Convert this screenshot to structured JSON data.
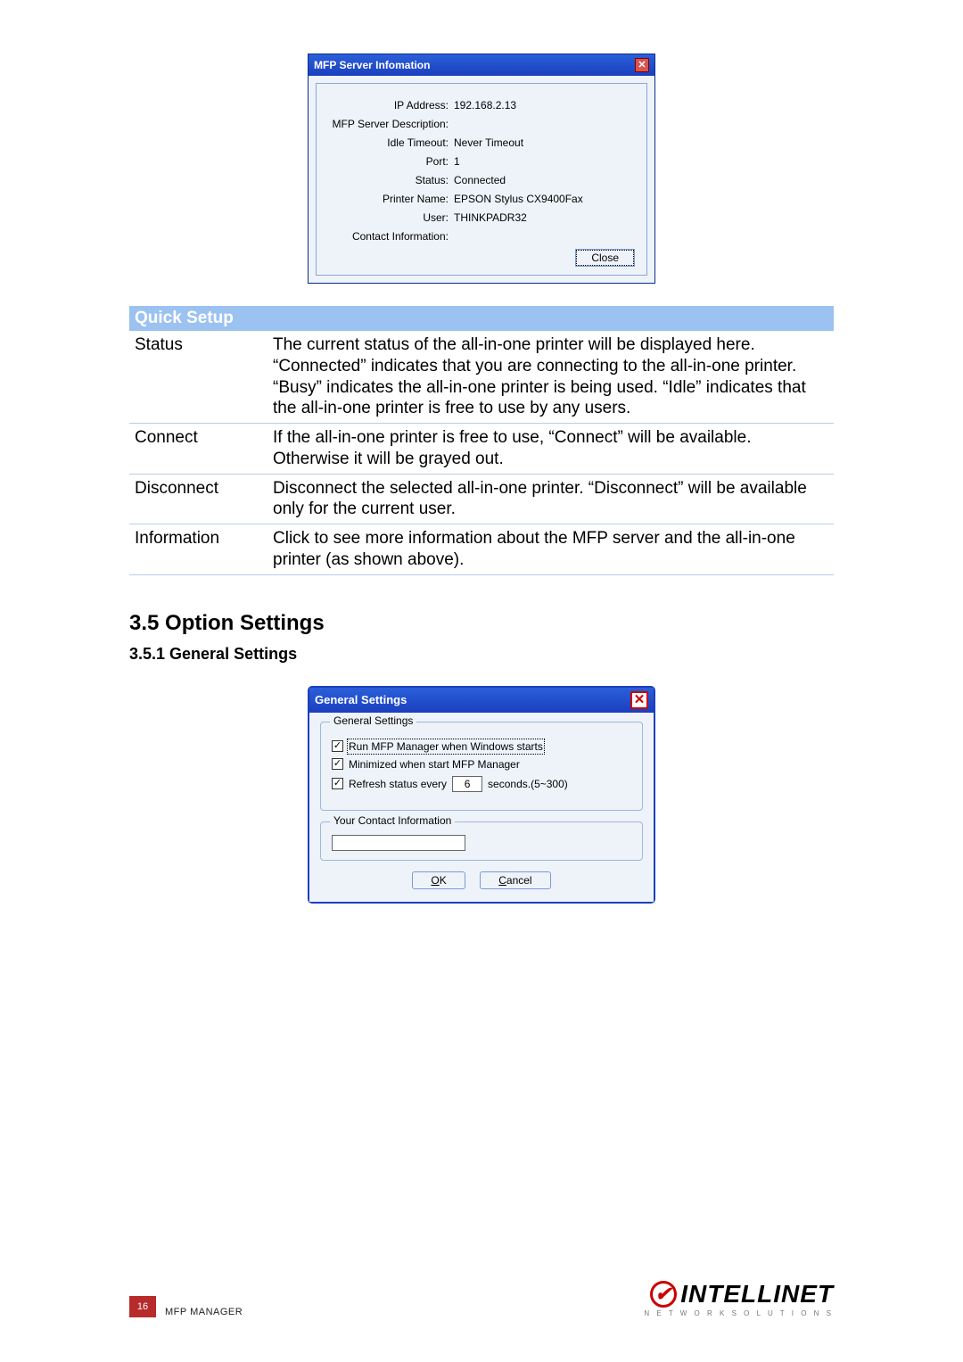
{
  "mfp_dialog": {
    "title": "MFP Server Infomation",
    "fields": {
      "ip_label": "IP Address:",
      "ip_value": "192.168.2.13",
      "desc_label": "MFP Server Description:",
      "desc_value": "",
      "idle_label": "Idle Timeout:",
      "idle_value": "Never Timeout",
      "port_label": "Port:",
      "port_value": "1",
      "status_label": "Status:",
      "status_value": "Connected",
      "printer_label": "Printer Name:",
      "printer_value": "EPSON Stylus CX9400Fax",
      "user_label": "User:",
      "user_value": "THINKPADR32",
      "contact_label": "Contact Information:",
      "contact_value": ""
    },
    "close_btn": "Close"
  },
  "quick_setup": {
    "header": "Quick Setup",
    "rows": [
      {
        "label": "Status",
        "desc": "The current status of the all-in-one printer will be displayed here. “Connected” indicates that you are connecting to the all-in-one printer. “Busy” indicates the all-in-one printer is being used. “Idle” indicates that the all-in-one printer is free to use by any users."
      },
      {
        "label": "Connect",
        "desc": "If the all-in-one printer is free to use, “Connect” will be available. Otherwise it will be grayed out."
      },
      {
        "label": "Disconnect",
        "desc": "Disconnect the selected all-in-one printer. “Disconnect” will be available only for the current user."
      },
      {
        "label": "Information",
        "desc": "Click to see more information about the MFP server and the all-in-one printer (as shown above)."
      }
    ]
  },
  "headings": {
    "h35": "3.5  Option Settings",
    "h351": "3.5.1  General Settings"
  },
  "gs_dialog": {
    "title": "General Settings",
    "group1": "General Settings",
    "chk1": "Run MFP Manager when Windows starts",
    "chk2": "Minimized when start MFP Manager",
    "chk3_pre": "Refresh status every",
    "chk3_val": "6",
    "chk3_post": "seconds.(5~300)",
    "group2": "Your Contact Information",
    "contact_val": "",
    "ok": "OK",
    "cancel": "Cancel"
  },
  "footer": {
    "page": "16",
    "section": "MFP MANAGER",
    "brand": "INTELLINET",
    "brand_sub": "N E T W O R K   S O L U T I O N S"
  }
}
